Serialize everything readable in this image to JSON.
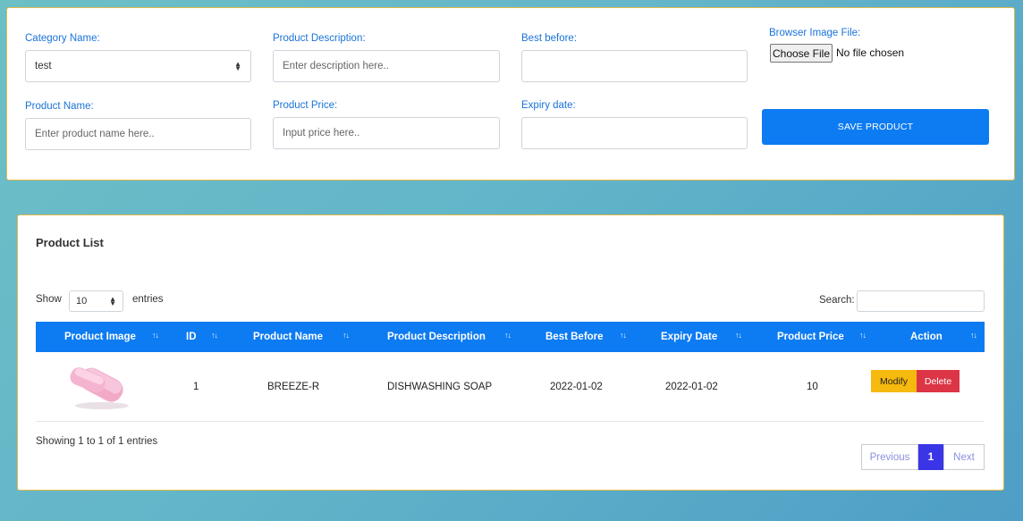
{
  "form": {
    "category_label": "Category Name:",
    "category_value": "test",
    "description_label": "Product Description:",
    "description_placeholder": "Enter description here..",
    "best_before_label": "Best before:",
    "image_label": "Browser Image File:",
    "choose_file_label": "Choose File",
    "no_file_text": "No file chosen",
    "product_name_label": "Product Name:",
    "product_name_placeholder": "Enter product name here..",
    "price_label": "Product Price:",
    "price_placeholder": "Input price here..",
    "expiry_label": "Expiry date:",
    "save_label": "SAVE PRODUCT"
  },
  "list": {
    "title": "Product List",
    "show_label": "Show",
    "page_length": "10",
    "entries_label": "entries",
    "search_label": "Search:",
    "columns": [
      "Product Image",
      "ID",
      "Product Name",
      "Product Description",
      "Best Before",
      "Expiry Date",
      "Product Price",
      "Action"
    ],
    "rows": [
      {
        "image": "pink-soap-bar-image",
        "id": "1",
        "name": "BREEZE-R",
        "description": "DISHWASHING SOAP",
        "best_before": "2022-01-02",
        "expiry_date": "2022-01-02",
        "price": "10",
        "modify_label": "Modify",
        "delete_label": "Delete"
      }
    ],
    "info_text": "Showing 1 to 1 of 1 entries",
    "pagination": {
      "previous": "Previous",
      "current": "1",
      "next": "Next"
    }
  },
  "colors": {
    "accent": "#0d7bf2",
    "label_blue": "#1a73d9",
    "modify": "#f6b90d",
    "delete": "#dc3545",
    "active_page": "#3b35e8"
  }
}
